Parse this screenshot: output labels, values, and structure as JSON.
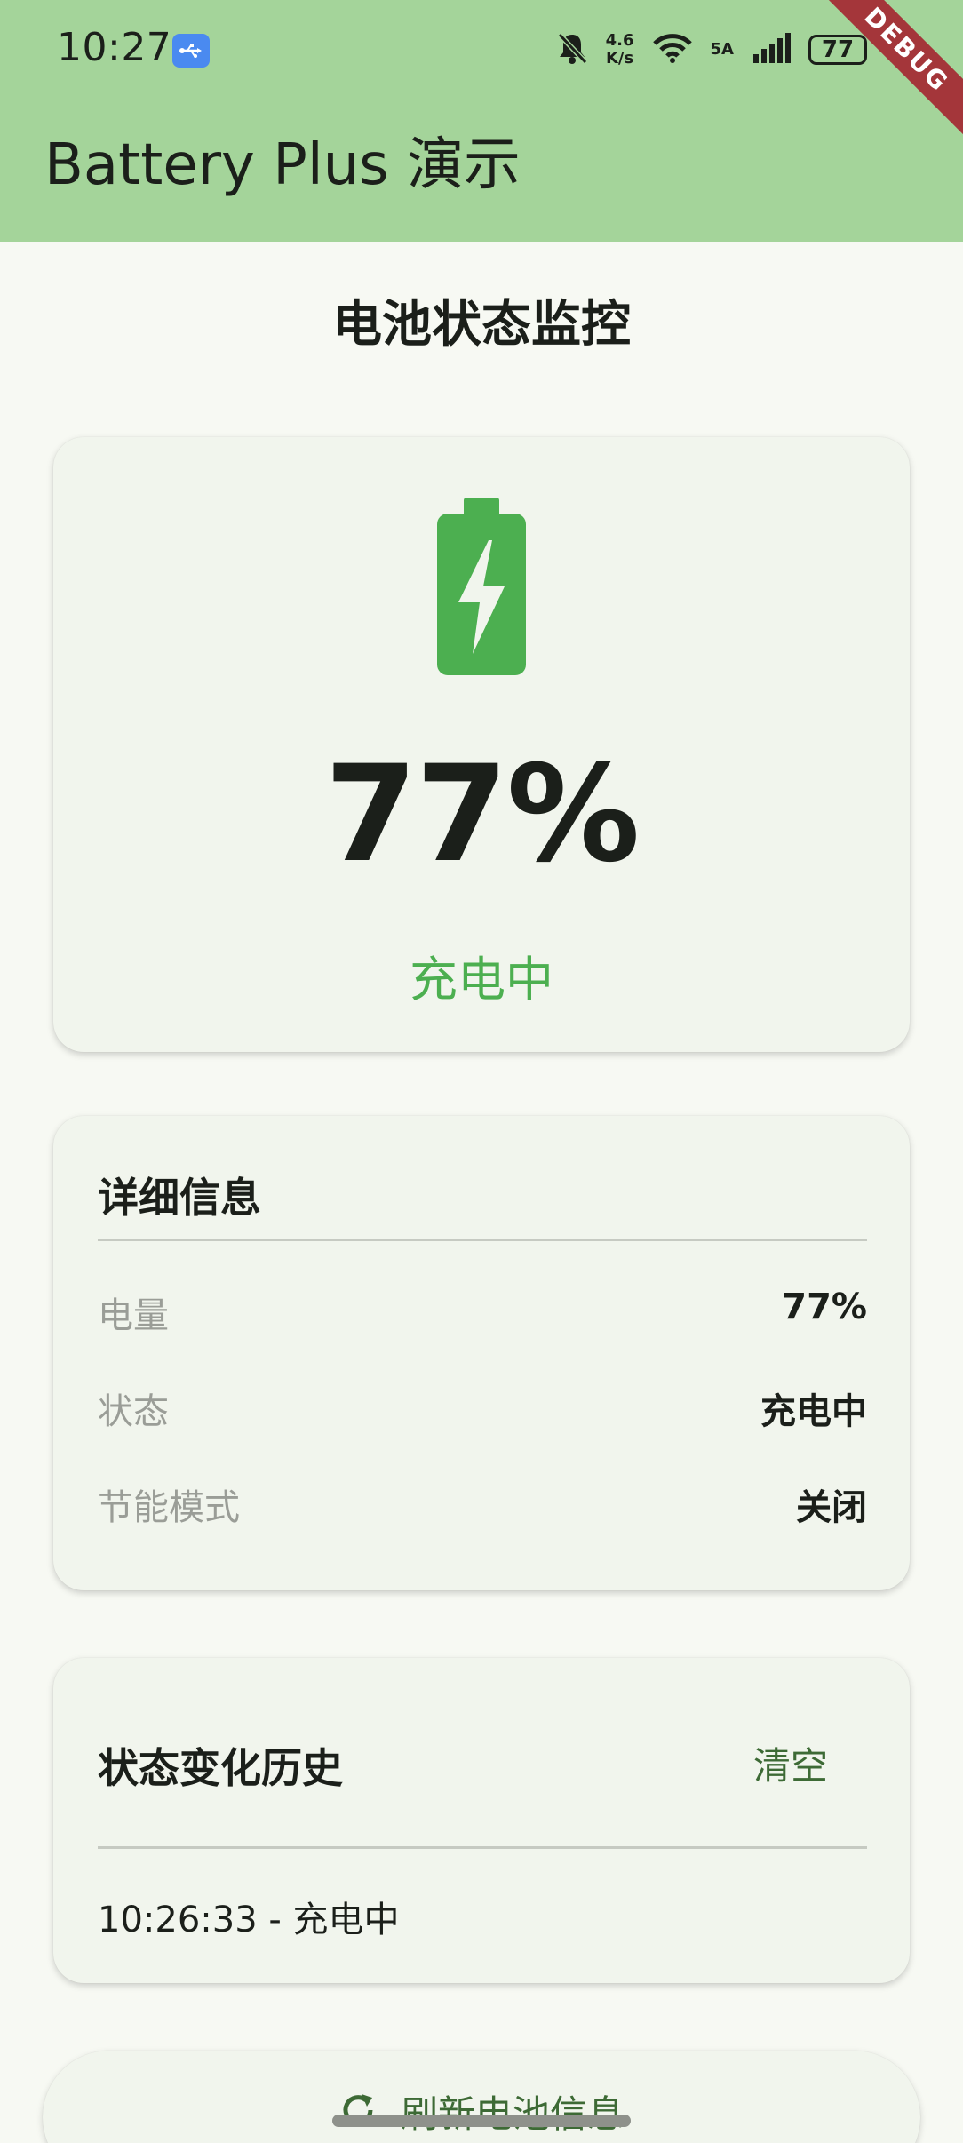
{
  "status_bar": {
    "time": "10:27",
    "net_speed_value": "4.6",
    "net_speed_unit": "K/s",
    "network_type": "5A",
    "battery_level": "77",
    "debug_label": "DEBUG"
  },
  "app_bar": {
    "title": "Battery Plus 演示",
    "color": "#a4d49a"
  },
  "page": {
    "heading": "电池状态监控"
  },
  "battery_card": {
    "percent": "77%",
    "state": "充电中",
    "icon": "battery-charging-icon",
    "accent_color": "#4caf50"
  },
  "details": {
    "title": "详细信息",
    "rows": [
      {
        "label": "电量",
        "value": "77%"
      },
      {
        "label": "状态",
        "value": "充电中"
      },
      {
        "label": "节能模式",
        "value": "关闭"
      }
    ]
  },
  "history": {
    "title": "状态变化历史",
    "clear_label": "清空",
    "entries": [
      "10:26:33 - 充电中"
    ]
  },
  "refresh": {
    "label": "刷新电池信息",
    "icon": "refresh-icon"
  }
}
